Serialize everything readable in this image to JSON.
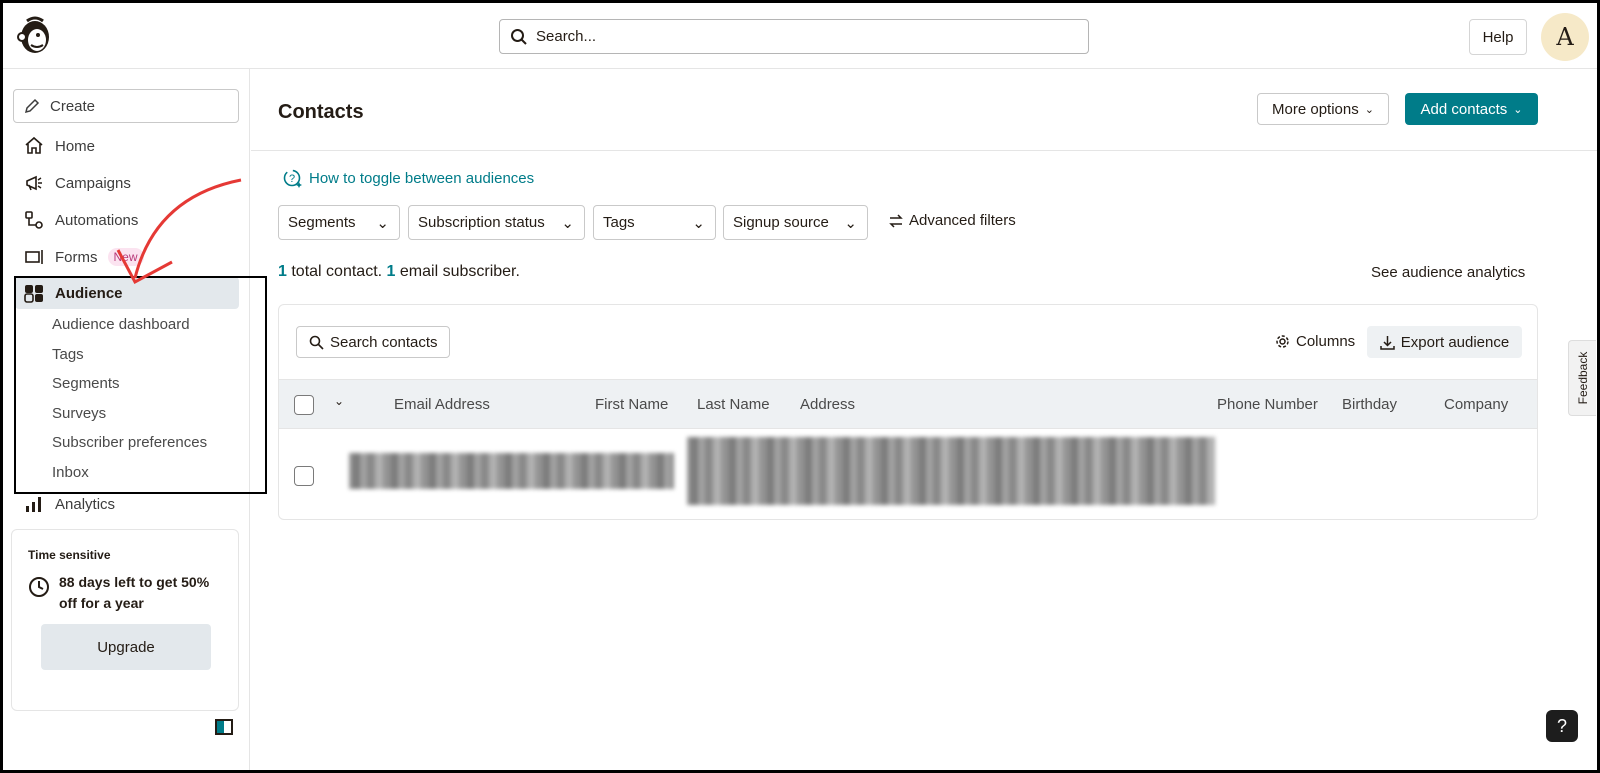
{
  "header": {
    "search_placeholder": "Search...",
    "help_label": "Help",
    "avatar_initial": "A"
  },
  "sidebar": {
    "create_label": "Create",
    "items": [
      {
        "label": "Home",
        "icon": "home-icon"
      },
      {
        "label": "Campaigns",
        "icon": "megaphone-icon"
      },
      {
        "label": "Automations",
        "icon": "automation-icon"
      },
      {
        "label": "Forms",
        "icon": "form-icon",
        "badge": "New"
      },
      {
        "label": "Audience",
        "icon": "audience-icon",
        "active": true
      },
      {
        "label": "Analytics",
        "icon": "bar-chart-icon"
      }
    ],
    "audience_subitems": [
      "Audience dashboard",
      "Tags",
      "Segments",
      "Surveys",
      "Subscriber preferences",
      "Inbox"
    ],
    "promo": {
      "label": "Time sensitive",
      "text": "88 days left to get 50% off for a year",
      "button": "Upgrade"
    }
  },
  "main": {
    "title": "Contacts",
    "more_options_label": "More options",
    "add_contacts_label": "Add contacts",
    "howto_link": "How to toggle between audiences",
    "filters": [
      "Segments",
      "Subscription status",
      "Tags",
      "Signup source"
    ],
    "advanced_filters_label": "Advanced filters",
    "totals": {
      "total_count": "1",
      "total_text": "total contact.",
      "subscriber_count": "1",
      "subscriber_text": "email subscriber."
    },
    "analytics_link": "See audience analytics",
    "table": {
      "search_label": "Search contacts",
      "columns_label": "Columns",
      "export_label": "Export audience",
      "headers": [
        "Email Address",
        "First Name",
        "Last Name",
        "Address",
        "Phone Number",
        "Birthday",
        "Company"
      ]
    }
  },
  "feedback_label": "Feedback",
  "help_fab": "?",
  "colors": {
    "accent": "#007c89",
    "active_bg": "#e3e8ec",
    "badge_bg": "#fbe3f0",
    "annotation_arrow": "#e53935"
  }
}
